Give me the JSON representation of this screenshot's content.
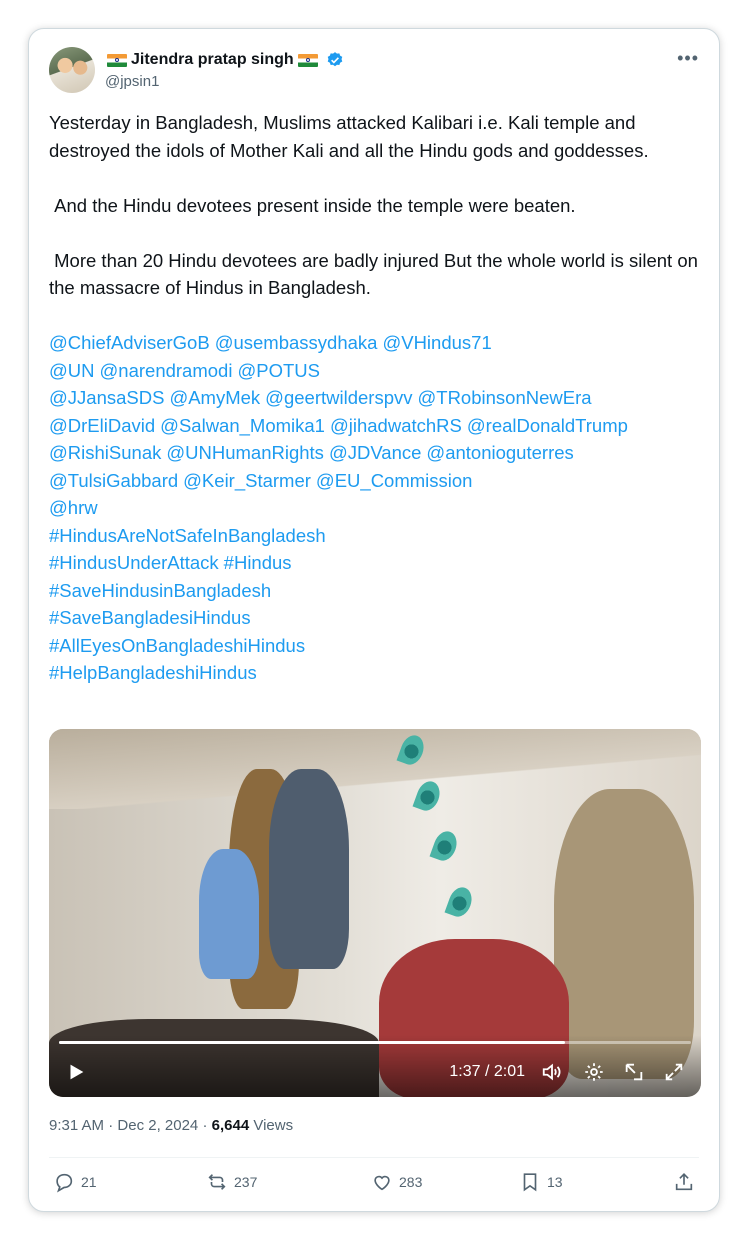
{
  "author": {
    "name": "Jitendra pratap singh",
    "handle": "@jpsin1",
    "verified": true,
    "flag_icon": "india-flag-icon"
  },
  "tweet": {
    "paragraphs": [
      "Yesterday in Bangladesh, Muslims attacked Kalibari i.e. Kali temple and destroyed the idols of Mother Kali and all the Hindu gods and goddesses.",
      " And the Hindu devotees present inside the temple were beaten.",
      " More than 20 Hindu devotees are badly injured But the whole world is silent on the massacre of Hindus in Bangladesh."
    ],
    "link_lines": [
      [
        "@ChiefAdviserGoB",
        "@usembassydhaka",
        "@VHindus71"
      ],
      [
        "@UN",
        "@narendramodi",
        "@POTUS"
      ],
      [
        "@JJansaSDS",
        "@AmyMek",
        "@geertwilderspvv",
        "@TRobinsonNewEra"
      ],
      [
        "@DrEliDavid",
        "@Salwan_Momika1",
        "@jihadwatchRS",
        "@realDonaldTrump"
      ],
      [
        "@RishiSunak",
        "@UNHumanRights",
        "@JDVance",
        "@antonioguterres"
      ],
      [
        "@TulsiGabbard",
        "@Keir_Starmer",
        "@EU_Commission"
      ],
      [
        "@hrw"
      ],
      [
        "#HindusAreNotSafeInBangladesh"
      ],
      [
        "#HindusUnderAttack",
        "#Hindus"
      ],
      [
        "#SaveHindusinBangladesh"
      ],
      [
        "#SaveBangladesiHindus"
      ],
      [
        "#AllEyesOnBangladeshiHindus"
      ],
      [
        "#HelpBangladeshiHindus"
      ]
    ]
  },
  "video": {
    "time": "1:37 / 2:01",
    "progress": 0.8
  },
  "meta": {
    "time": "9:31 AM",
    "date": "Dec 2, 2024",
    "views_count": "6,644",
    "views_label": "Views"
  },
  "actions": {
    "replies": "21",
    "reposts": "237",
    "likes": "283",
    "bookmarks": "13"
  }
}
